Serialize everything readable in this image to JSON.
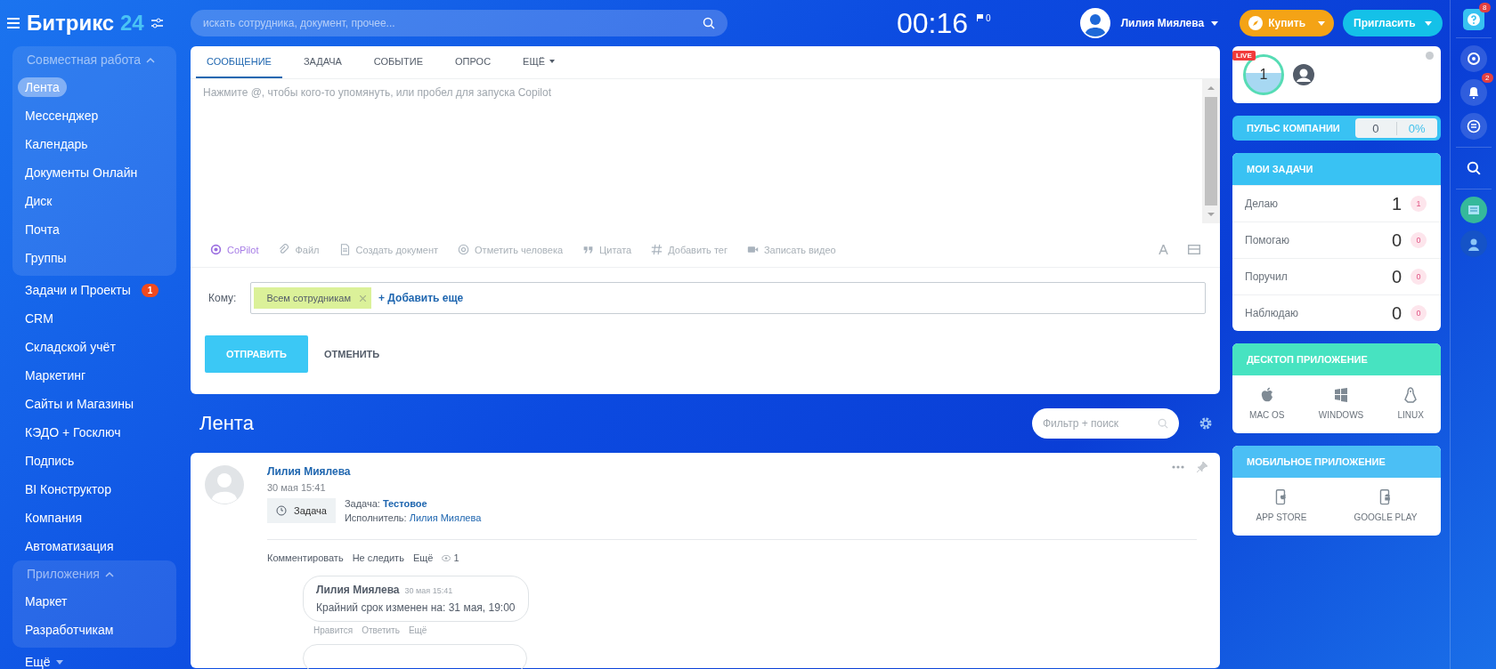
{
  "header": {
    "logo_text": "Битрикс",
    "logo_number": "24",
    "search_placeholder": "искать сотрудника, документ, прочее...",
    "timer": "00:16",
    "flag_count": "0",
    "user_name": "Лилия Миялева",
    "buy_button": "Купить",
    "invite_button": "Пригласить"
  },
  "sidebar": {
    "items": [
      {
        "kind": "group",
        "label": "Совместная работа",
        "expanded": true,
        "children": [
          {
            "label": "Лента",
            "selected": true
          },
          {
            "label": "Мессенджер",
            "selected": false
          },
          {
            "label": "Календарь",
            "selected": false
          },
          {
            "label": "Документы Онлайн",
            "selected": false
          },
          {
            "label": "Диск",
            "selected": false
          },
          {
            "label": "Почта",
            "selected": false
          },
          {
            "label": "Группы",
            "selected": false
          }
        ]
      },
      {
        "kind": "link",
        "label": "Задачи и Проекты",
        "selected": false,
        "badge": "1"
      },
      {
        "kind": "link",
        "label": "CRM",
        "selected": false
      },
      {
        "kind": "link",
        "label": "Складской учёт",
        "selected": false
      },
      {
        "kind": "link",
        "label": "Маркетинг",
        "selected": false
      },
      {
        "kind": "link",
        "label": "Сайты и Магазины",
        "selected": false
      },
      {
        "kind": "link",
        "label": "КЭДО + Госключ",
        "selected": false
      },
      {
        "kind": "link",
        "label": "Подпись",
        "selected": false
      },
      {
        "kind": "link",
        "label": "BI Конструктор",
        "selected": false
      },
      {
        "kind": "link",
        "label": "Компания",
        "selected": false
      },
      {
        "kind": "link",
        "label": "Автоматизация",
        "selected": false
      },
      {
        "kind": "group",
        "label": "Приложения",
        "expanded": true,
        "children": [
          {
            "label": "Маркет",
            "selected": false
          },
          {
            "label": "Разработчикам",
            "selected": false
          }
        ]
      },
      {
        "kind": "more",
        "label": "Ещё",
        "selected": false
      }
    ]
  },
  "composer": {
    "tabs": [
      {
        "label": "СООБЩЕНИЕ",
        "selected": true
      },
      {
        "label": "ЗАДАЧА",
        "selected": false
      },
      {
        "label": "СОБЫТИЕ",
        "selected": false
      },
      {
        "label": "ОПРОС",
        "selected": false
      },
      {
        "label": "ЕЩЁ",
        "selected": false,
        "dropdown": true
      }
    ],
    "placeholder": "Нажмите @, чтобы кого-то упомянуть, или пробел для запуска Copilot",
    "tools": [
      {
        "kind": "copilot",
        "label": "CoPilot"
      },
      {
        "kind": "file",
        "label": "Файл"
      },
      {
        "kind": "document",
        "label": "Создать документ"
      },
      {
        "kind": "mention",
        "label": "Отметить человека"
      },
      {
        "kind": "quote",
        "label": "Цитата"
      },
      {
        "kind": "tag",
        "label": "Добавить тег"
      },
      {
        "kind": "video",
        "label": "Записать видео"
      }
    ],
    "recipients_label": "Кому:",
    "recipients": [
      {
        "label": "Всем сотрудникам"
      }
    ],
    "add_more": "+ Добавить еще",
    "send_button": "ОТПРАВИТЬ",
    "cancel_button": "ОТМЕНИТЬ"
  },
  "feed": {
    "title": "Лента",
    "filter_placeholder": "Фильтр + поиск",
    "post": {
      "author": "Лилия Миялева",
      "date": "30 мая 15:41",
      "task_chip": "Задача",
      "task_label": "Задача:",
      "task_title": "Тестовое",
      "assignee_label": "Исполнитель:",
      "assignee": "Лилия Миялева",
      "actions": [
        "Комментировать",
        "Не следить",
        "Ещё"
      ],
      "views": "1",
      "comments": [
        {
          "author": "Лилия Миялева",
          "time": "30 мая 15:41",
          "text": "Крайний срок изменен на: 31 мая, 19:00",
          "actions": [
            "Нравится",
            "Ответить",
            "Ещё"
          ]
        }
      ]
    }
  },
  "right": {
    "live": {
      "badge": "LIVE",
      "count": "1"
    },
    "pulse": {
      "label": "ПУЛЬС КОМПАНИИ",
      "count": "0",
      "percent": "0%"
    },
    "tasks": {
      "title": "МОИ ЗАДАЧИ",
      "items": [
        {
          "label": "Делаю",
          "count": "1",
          "badge": "1"
        },
        {
          "label": "Помогаю",
          "count": "0",
          "badge": "0"
        },
        {
          "label": "Поручил",
          "count": "0",
          "badge": "0"
        },
        {
          "label": "Наблюдаю",
          "count": "0",
          "badge": "0"
        }
      ]
    },
    "desktop": {
      "title": "ДЕСКТОП ПРИЛОЖЕНИЕ",
      "apps": [
        {
          "kind": "mac",
          "label": "MAC OS"
        },
        {
          "kind": "windows",
          "label": "WINDOWS"
        },
        {
          "kind": "linux",
          "label": "LINUX"
        }
      ]
    },
    "mobile": {
      "title": "МОБИЛЬНОЕ ПРИЛОЖЕНИЕ",
      "apps": [
        {
          "kind": "ios",
          "label": "APP STORE"
        },
        {
          "kind": "android",
          "label": "GOOGLE PLAY"
        }
      ]
    }
  },
  "strip": {
    "help_badge": "8",
    "notifications_badge": "2"
  }
}
